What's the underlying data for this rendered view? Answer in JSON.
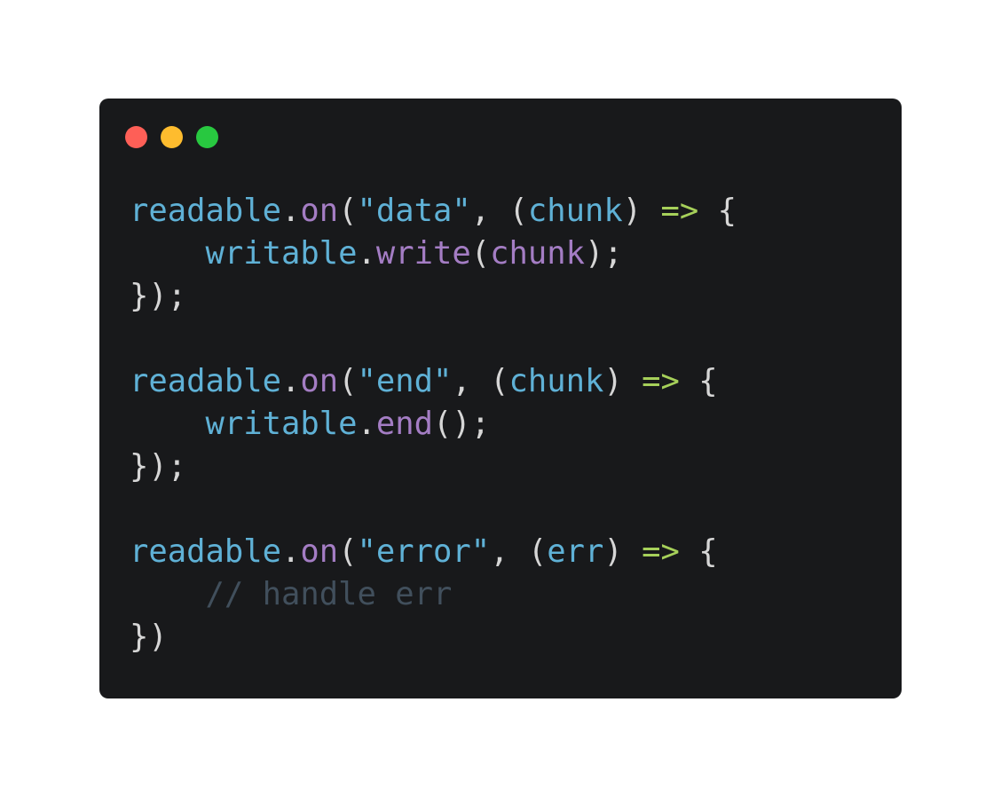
{
  "colors": {
    "background": "#ffffff",
    "window": "#18191b",
    "dot_red": "#fe5f57",
    "dot_yellow": "#febc2e",
    "dot_green": "#28c840",
    "identifier": "#5fb1d6",
    "method": "#a47dc4",
    "arrow": "#a6d05a",
    "punctuation": "#d6d6d6",
    "comment": "#414f5c"
  },
  "code": {
    "lines": [
      [
        {
          "t": "readable",
          "k": "obj"
        },
        {
          "t": ".",
          "k": "punc"
        },
        {
          "t": "on",
          "k": "fn"
        },
        {
          "t": "(",
          "k": "punc"
        },
        {
          "t": "\"data\"",
          "k": "str"
        },
        {
          "t": ", (",
          "k": "punc"
        },
        {
          "t": "chunk",
          "k": "param"
        },
        {
          "t": ") ",
          "k": "punc"
        },
        {
          "t": "=>",
          "k": "arrow"
        },
        {
          "t": " {",
          "k": "punc"
        }
      ],
      [
        {
          "t": "    ",
          "k": "punc"
        },
        {
          "t": "writable",
          "k": "obj"
        },
        {
          "t": ".",
          "k": "punc"
        },
        {
          "t": "write",
          "k": "fn"
        },
        {
          "t": "(",
          "k": "punc"
        },
        {
          "t": "chunk",
          "k": "argfn"
        },
        {
          "t": ");",
          "k": "punc"
        }
      ],
      [
        {
          "t": "});",
          "k": "punc"
        }
      ],
      [],
      [
        {
          "t": "readable",
          "k": "obj"
        },
        {
          "t": ".",
          "k": "punc"
        },
        {
          "t": "on",
          "k": "fn"
        },
        {
          "t": "(",
          "k": "punc"
        },
        {
          "t": "\"end\"",
          "k": "str"
        },
        {
          "t": ", (",
          "k": "punc"
        },
        {
          "t": "chunk",
          "k": "param"
        },
        {
          "t": ") ",
          "k": "punc"
        },
        {
          "t": "=>",
          "k": "arrow"
        },
        {
          "t": " {",
          "k": "punc"
        }
      ],
      [
        {
          "t": "    ",
          "k": "punc"
        },
        {
          "t": "writable",
          "k": "obj"
        },
        {
          "t": ".",
          "k": "punc"
        },
        {
          "t": "end",
          "k": "fn"
        },
        {
          "t": "();",
          "k": "punc"
        }
      ],
      [
        {
          "t": "});",
          "k": "punc"
        }
      ],
      [],
      [
        {
          "t": "readable",
          "k": "obj"
        },
        {
          "t": ".",
          "k": "punc"
        },
        {
          "t": "on",
          "k": "fn"
        },
        {
          "t": "(",
          "k": "punc"
        },
        {
          "t": "\"error\"",
          "k": "str"
        },
        {
          "t": ", (",
          "k": "punc"
        },
        {
          "t": "err",
          "k": "param"
        },
        {
          "t": ") ",
          "k": "punc"
        },
        {
          "t": "=>",
          "k": "arrow"
        },
        {
          "t": " {",
          "k": "punc"
        }
      ],
      [
        {
          "t": "    ",
          "k": "punc"
        },
        {
          "t": "// handle err",
          "k": "comment"
        }
      ],
      [
        {
          "t": "})",
          "k": "punc"
        }
      ]
    ]
  }
}
